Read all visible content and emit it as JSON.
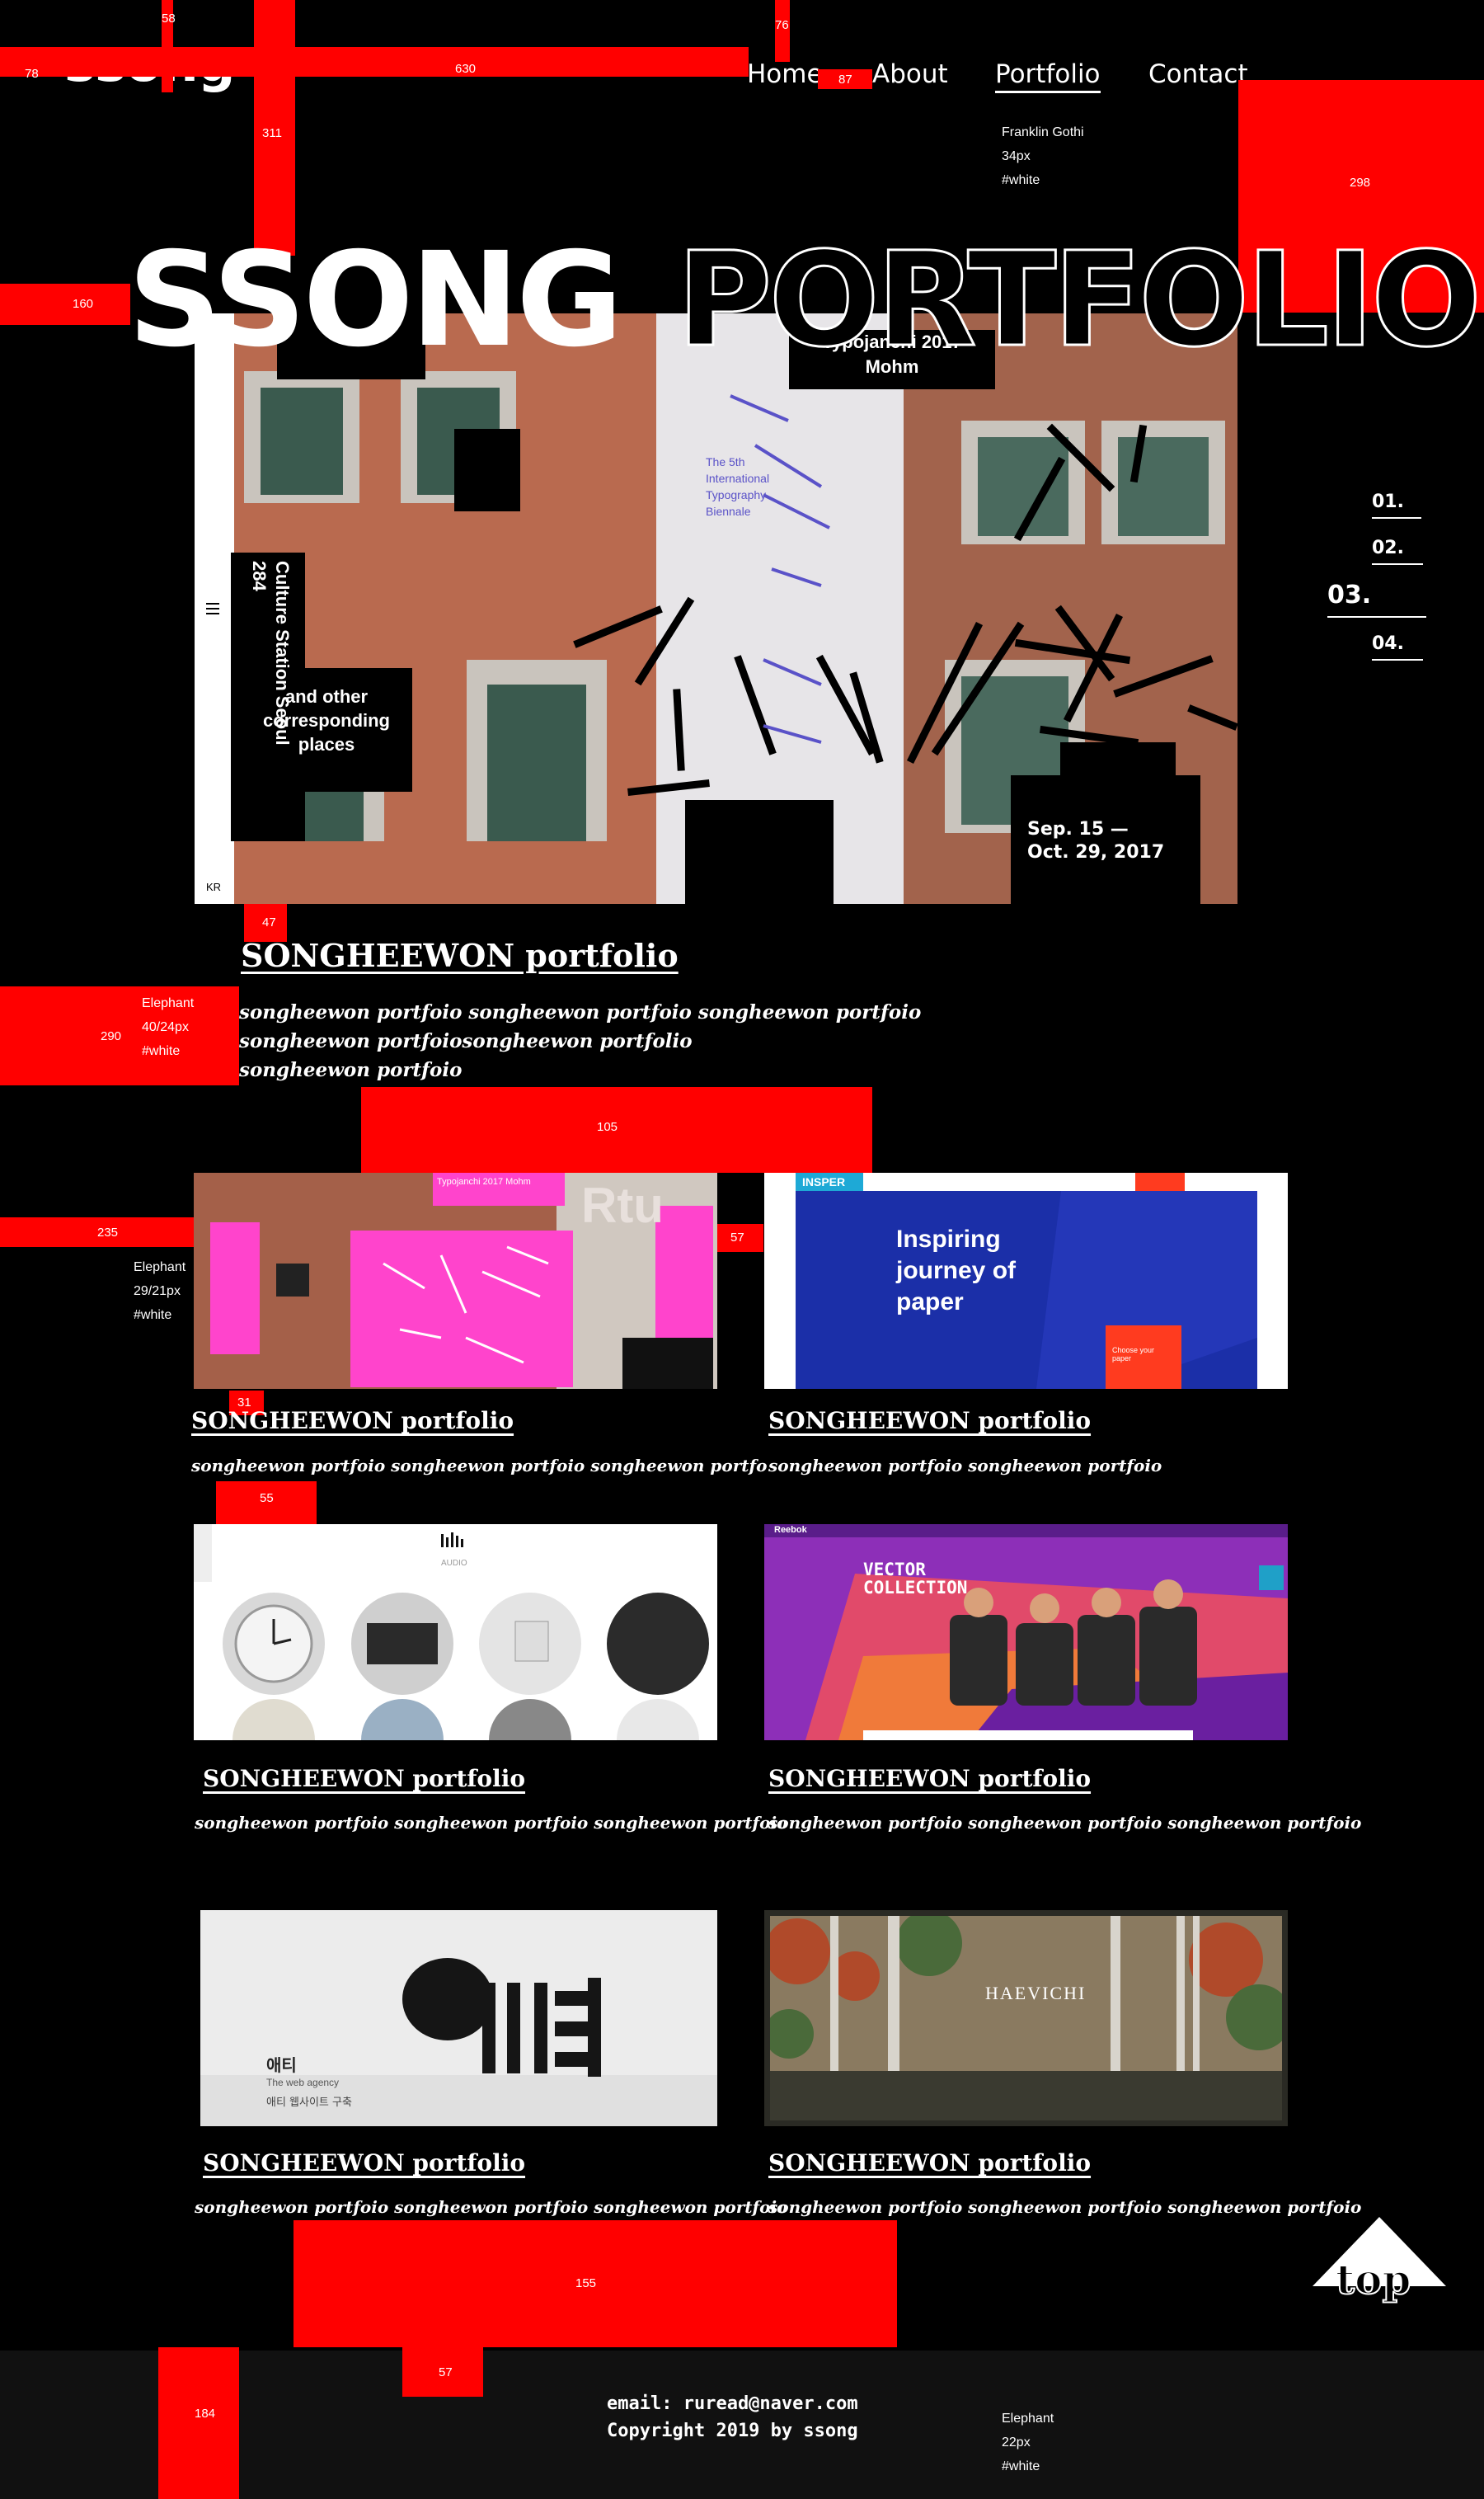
{
  "logo": "ssong",
  "nav": {
    "home": "Home",
    "about": "About",
    "portfolio": "Portfolio",
    "contact": "Contact"
  },
  "nav_note": {
    "font": "Franklin Gothi",
    "size": "34px",
    "color": "#white"
  },
  "hero": {
    "title_solid": "SSONG",
    "title_outline": "PORTFOLIO",
    "poster": {
      "top_text_1": "Typojanchi 2017",
      "top_text_2": "Mohm",
      "vertical_text": "Culture Station Seoul 284",
      "side_text": "and other corresponding places",
      "date_text": "Sep. 15 — Oct. 29, 2017",
      "lang_tag": "KR",
      "center_text": "The 5th International Typography Biennale"
    }
  },
  "pager": [
    "01.",
    "02.",
    "03.",
    "04."
  ],
  "main_project": {
    "title": "SONGHEEWON portfolio",
    "desc_1": "songheewon portfoio songheewon portfoio songheewon portfoio",
    "desc_2": "songheewon portfoiosongheewon portfolio",
    "desc_3": "songheewon portfoio"
  },
  "main_note": {
    "font": "Elephant",
    "size": "40/24px",
    "color": "#white"
  },
  "grid_note": {
    "font": "Elephant",
    "size": "29/21px",
    "color": "#white"
  },
  "footer_note": {
    "font": "Elephant",
    "size": "22px",
    "color": "#white"
  },
  "projects": [
    {
      "title": "SONGHEEWON portfolio",
      "desc": "songheewon portfoio songheewon portfoio songheewon portfo",
      "thumb_text": "Typojanchi 2017 Mohm"
    },
    {
      "title": "SONGHEEWON portfolio",
      "desc": "songheewon portfoio songheewon portfoio",
      "thumb_text": "Inspiring journey of paper",
      "brand": "INSPER",
      "cta": "Choose your paper"
    },
    {
      "title": "SONGHEEWON portfolio",
      "desc": "songheewon portfoio songheewon portfoio songheewon portfoio",
      "thumb_text": "AUDIO"
    },
    {
      "title": "SONGHEEWON portfolio",
      "desc": "songheewon portfoio songheewon portfoio songheewon portfoio",
      "thumb_text": "VECTOR COLLECTION",
      "brand": "Reebok"
    },
    {
      "title": "SONGHEEWON portfolio",
      "desc": "songheewon portfoio songheewon portfoio songheewon portfoio",
      "thumb_text": "애티",
      "caption_1": "The web agency",
      "caption_2": "애티 웹사이트 구축"
    },
    {
      "title": "SONGHEEWON portfolio",
      "desc": "songheewon portfoio songheewon portfoio songheewon portfoio",
      "thumb_text": "HAEVICHI"
    }
  ],
  "top_button": "top",
  "footer": {
    "email": "email: ruread@naver.com",
    "copyright": "Copyright 2019 by ssong"
  },
  "guides": [
    "58",
    "76",
    "78",
    "630",
    "87",
    "311",
    "298",
    "160",
    "47",
    "290",
    "105",
    "235",
    "57",
    "31",
    "55",
    "155",
    "57",
    "184"
  ],
  "colors": {
    "accent": "#ff0000",
    "background": "#000000",
    "footer_bg": "#111111"
  }
}
